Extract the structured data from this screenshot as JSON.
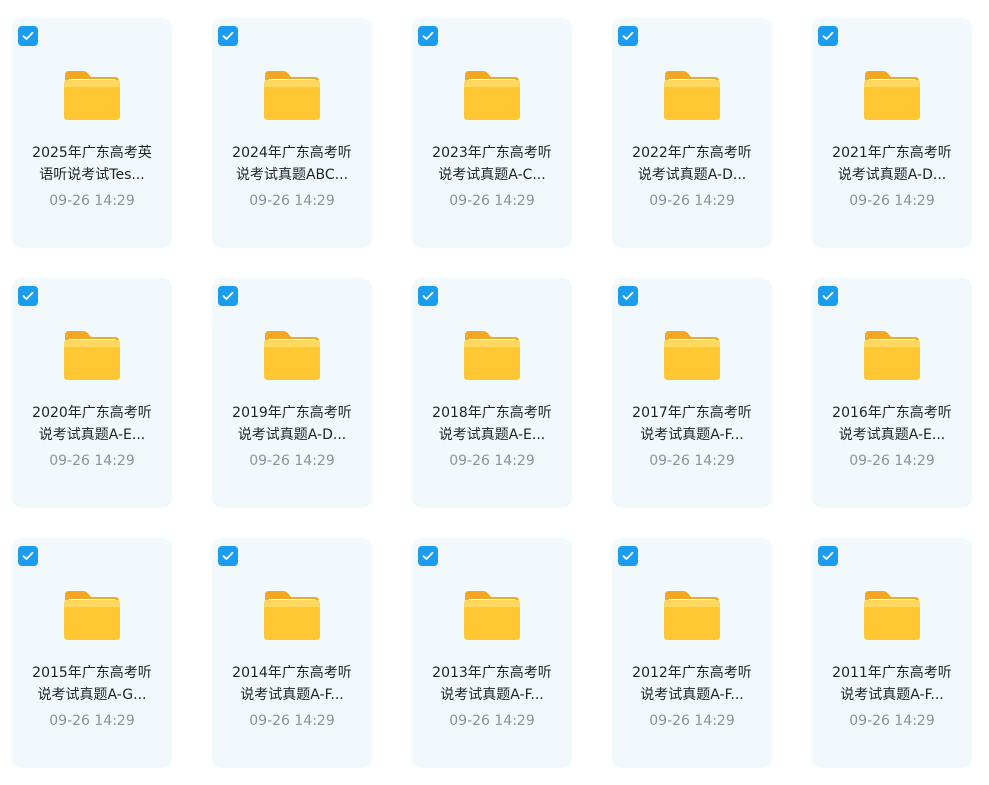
{
  "folders": [
    {
      "line1": "2025年广东高考英",
      "line2": "语听说考试Tes...",
      "date": "09-26 14:29",
      "checked": true
    },
    {
      "line1": "2024年广东高考听",
      "line2": "说考试真题ABC...",
      "date": "09-26 14:29",
      "checked": true
    },
    {
      "line1": "2023年广东高考听",
      "line2": "说考试真题A-C...",
      "date": "09-26 14:29",
      "checked": true
    },
    {
      "line1": "2022年广东高考听",
      "line2": "说考试真题A-D...",
      "date": "09-26 14:29",
      "checked": true
    },
    {
      "line1": "2021年广东高考听",
      "line2": "说考试真题A-D...",
      "date": "09-26 14:29",
      "checked": true
    },
    {
      "line1": "2020年广东高考听",
      "line2": "说考试真题A-E...",
      "date": "09-26 14:29",
      "checked": true
    },
    {
      "line1": "2019年广东高考听",
      "line2": "说考试真题A-D...",
      "date": "09-26 14:29",
      "checked": true
    },
    {
      "line1": "2018年广东高考听",
      "line2": "说考试真题A-E...",
      "date": "09-26 14:29",
      "checked": true
    },
    {
      "line1": "2017年广东高考听",
      "line2": "说考试真题A-F...",
      "date": "09-26 14:29",
      "checked": true
    },
    {
      "line1": "2016年广东高考听",
      "line2": "说考试真题A-E...",
      "date": "09-26 14:29",
      "checked": true
    },
    {
      "line1": "2015年广东高考听",
      "line2": "说考试真题A-G...",
      "date": "09-26 14:29",
      "checked": true
    },
    {
      "line1": "2014年广东高考听",
      "line2": "说考试真题A-F...",
      "date": "09-26 14:29",
      "checked": true
    },
    {
      "line1": "2013年广东高考听",
      "line2": "说考试真题A-F...",
      "date": "09-26 14:29",
      "checked": true
    },
    {
      "line1": "2012年广东高考听",
      "line2": "说考试真题A-F...",
      "date": "09-26 14:29",
      "checked": true
    },
    {
      "line1": "2011年广东高考听",
      "line2": "说考试真题A-F...",
      "date": "09-26 14:29",
      "checked": true
    }
  ],
  "colors": {
    "card_background": "#f1f9fd",
    "checkbox_accent": "#1a9df0",
    "folder_body": "#ffc832",
    "folder_tab": "#f5a623",
    "name_text": "#1f2329",
    "date_text": "#8a94a0"
  },
  "icons": {
    "folder": "folder-icon",
    "checkbox": "checkmark-icon"
  }
}
